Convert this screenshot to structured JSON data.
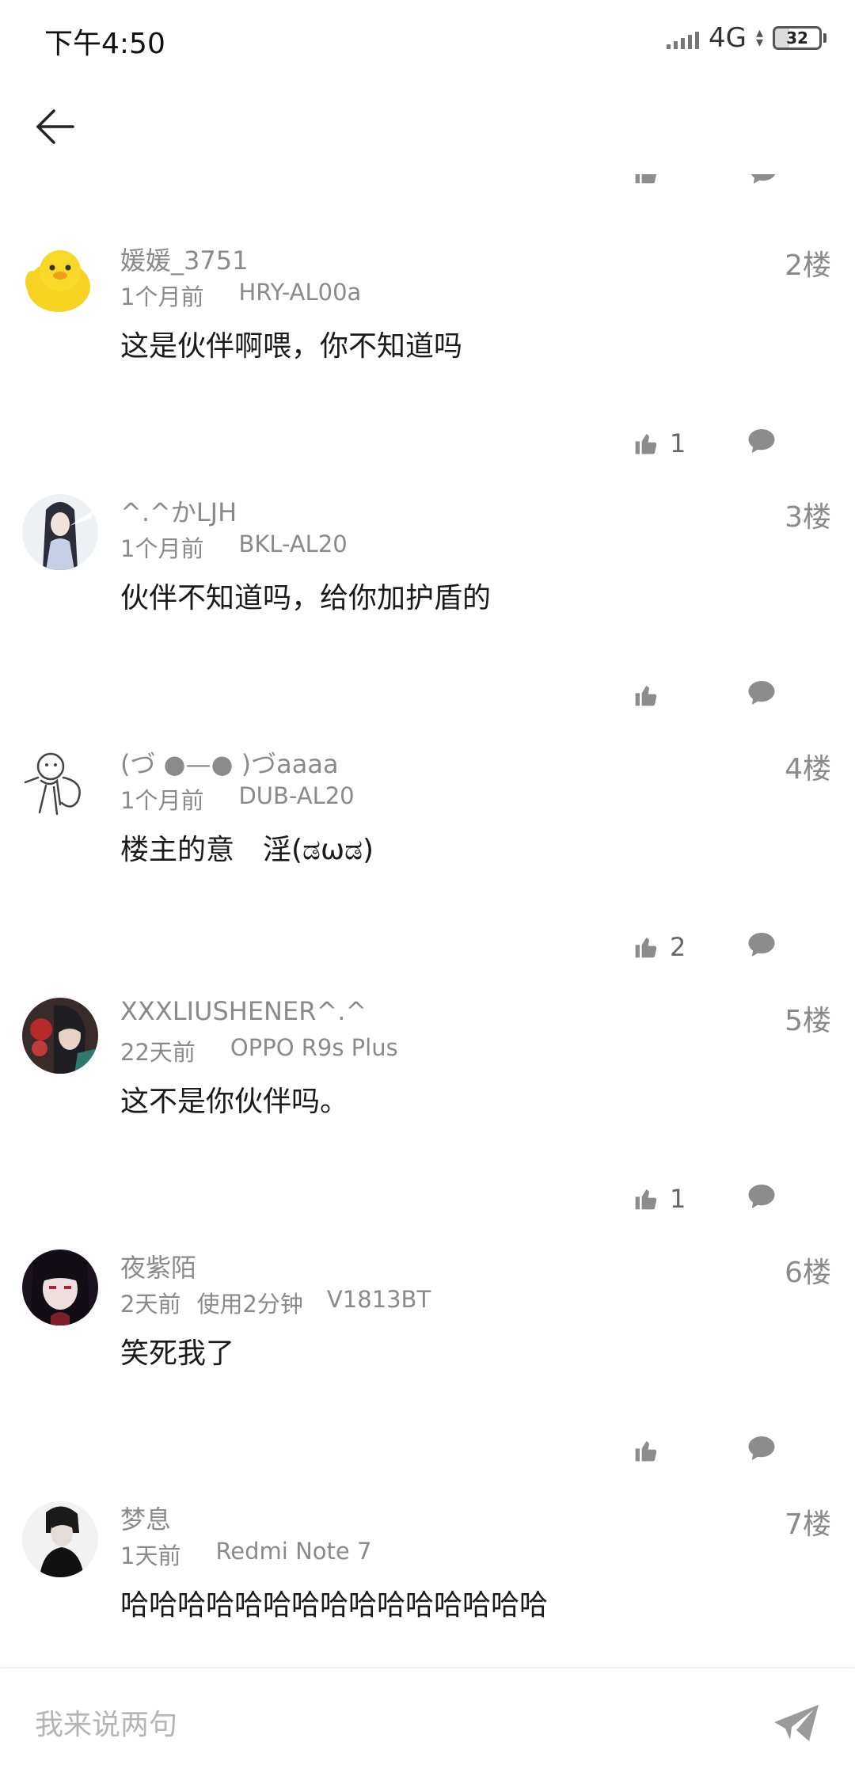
{
  "status_bar": {
    "time": "下午4:50",
    "network": "4G",
    "battery": "32"
  },
  "comments": [
    {
      "username": "媛媛_3751",
      "time": "1个月前",
      "device": "HRY-AL00a",
      "floor": "2楼",
      "content": "这是伙伴啊喂，你不知道吗",
      "likes": "1"
    },
    {
      "username": "^.^かLJH",
      "time": "1个月前",
      "device": "BKL-AL20",
      "floor": "3楼",
      "content": "伙伴不知道吗，给你加护盾的",
      "likes": ""
    },
    {
      "username": "(づ ●—● )づaaaa",
      "time": "1个月前",
      "device": "DUB-AL20",
      "floor": "4楼",
      "content": "楼主的意　淫(ಡωಡ)",
      "likes": "2"
    },
    {
      "username": "XXXLIUSHENER^.^",
      "time": "22天前",
      "device": "OPPO R9s Plus",
      "floor": "5楼",
      "content": "这不是你伙伴吗。",
      "likes": "1"
    },
    {
      "username": "夜紫陌",
      "time": "2天前",
      "usage": "使用2分钟",
      "device": "V1813BT",
      "floor": "6楼",
      "content": "笑死我了",
      "likes": ""
    },
    {
      "username": "梦息",
      "time": "1天前",
      "device": "Redmi Note 7",
      "floor": "7楼",
      "content": "哈哈哈哈哈哈哈哈哈哈哈哈哈哈哈",
      "likes": ""
    }
  ],
  "input": {
    "placeholder": "我来说两句"
  },
  "icons": {
    "back": "arrow-left-icon",
    "like": "thumbs-up-icon",
    "reply": "comment-bubble-icon",
    "send": "paper-plane-icon"
  },
  "colors": {
    "icon_gray": "#8c8c8c",
    "meta_gray": "#8a8a8a",
    "text": "#1a1a1a"
  }
}
